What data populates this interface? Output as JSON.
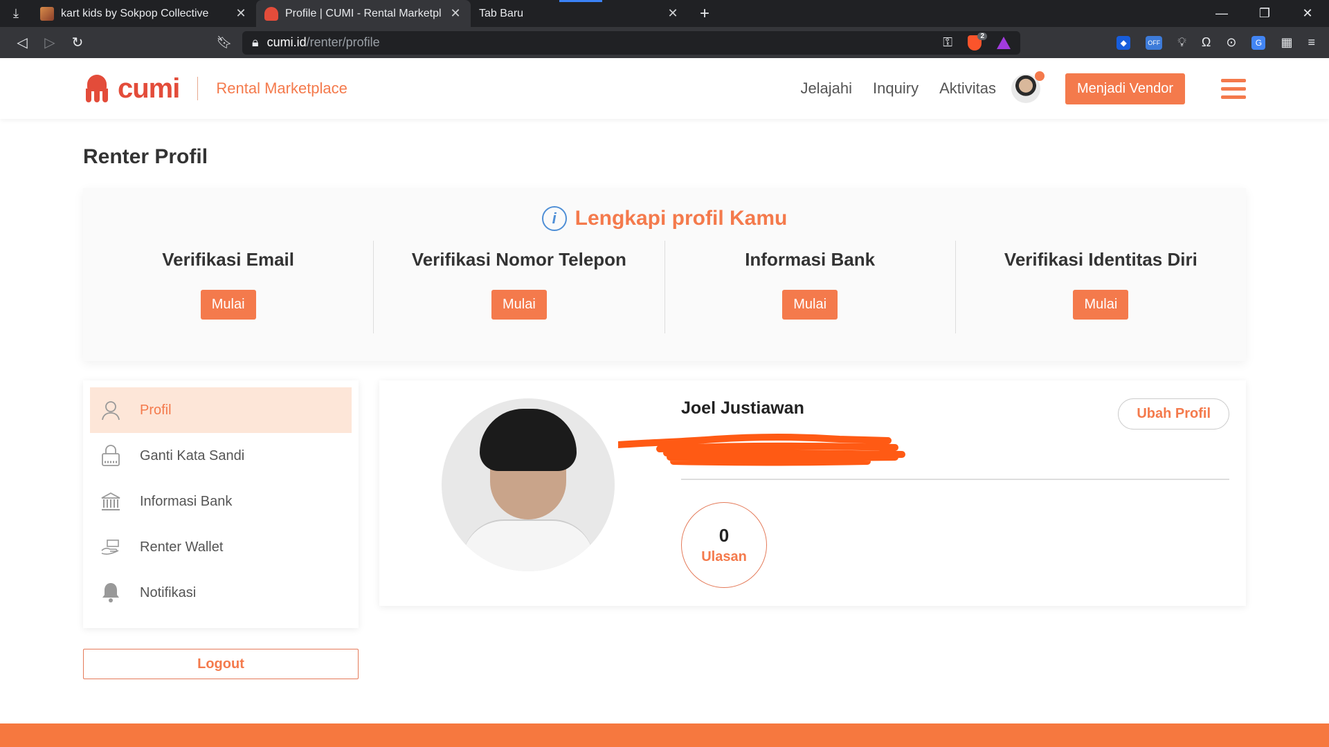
{
  "browser": {
    "tabs": [
      {
        "title": "kart kids by Sokpop Collective"
      },
      {
        "title": "Profile | CUMI - Rental Marketplace"
      },
      {
        "title": "Tab Baru"
      }
    ],
    "url_host": "cumi.id",
    "url_path": "/renter/profile",
    "brave_count": "2",
    "ext_off_label": "OFF"
  },
  "site": {
    "logo_text": "cumi",
    "logo_sub": "Rental Marketplace",
    "nav": [
      "Jelajahi",
      "Inquiry",
      "Aktivitas"
    ],
    "vendor_button": "Menjadi Vendor"
  },
  "page": {
    "title": "Renter Profil",
    "verif_heading": "Lengkapi profil Kamu",
    "verif_items": [
      {
        "label": "Verifikasi Email",
        "button": "Mulai"
      },
      {
        "label": "Verifikasi Nomor Telepon",
        "button": "Mulai"
      },
      {
        "label": "Informasi Bank",
        "button": "Mulai"
      },
      {
        "label": "Verifikasi Identitas Diri",
        "button": "Mulai"
      }
    ],
    "sidebar": [
      {
        "label": "Profil",
        "icon": "user-icon"
      },
      {
        "label": "Ganti Kata Sandi",
        "icon": "lock-icon"
      },
      {
        "label": "Informasi Bank",
        "icon": "bank-icon"
      },
      {
        "label": "Renter Wallet",
        "icon": "wallet-icon"
      },
      {
        "label": "Notifikasi",
        "icon": "bell-icon"
      }
    ],
    "logout": "Logout",
    "profile": {
      "name": "Joel Justiawan",
      "edit_button": "Ubah Profil",
      "review_count": "0",
      "review_label": "Ulasan"
    }
  },
  "colors": {
    "accent": "#f47a4c",
    "redaction": "#ff5a14",
    "footer": "#f6783f"
  }
}
